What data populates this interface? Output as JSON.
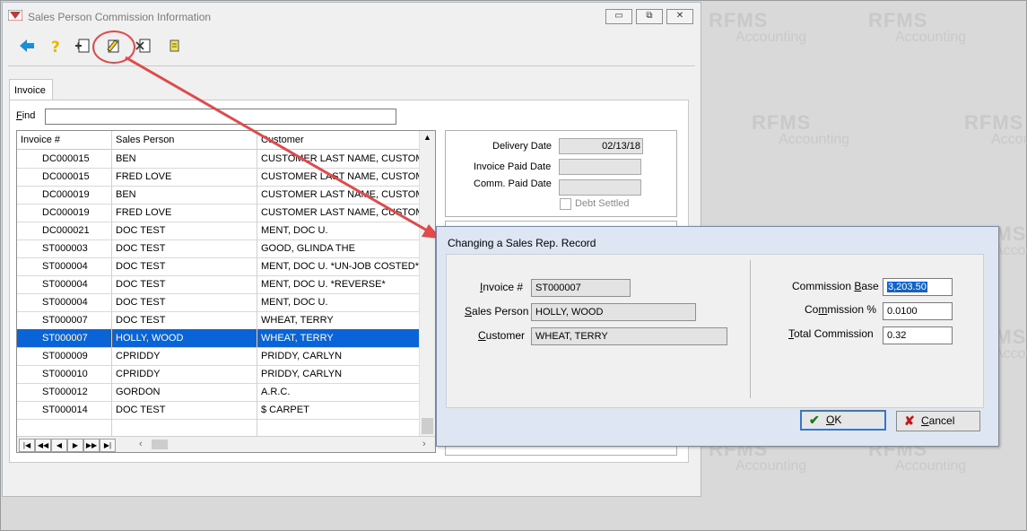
{
  "watermark": {
    "brand": "RFMS",
    "sub": "Accounting"
  },
  "window": {
    "title": "Sales Person Commission Information",
    "controls": {
      "minimize": "▭",
      "restore": "⧉",
      "close": "✕"
    }
  },
  "toolbar": {
    "icons": [
      "back-arrow-icon",
      "help-icon",
      "add-record-icon",
      "edit-record-icon",
      "delete-record-icon",
      "report-icon"
    ]
  },
  "tab": {
    "label": "Invoice"
  },
  "find": {
    "label_first": "F",
    "label_rest": "ind",
    "value": ""
  },
  "grid": {
    "columns": [
      "Invoice #",
      "Sales Person",
      "Customer"
    ],
    "rows": [
      [
        "DC000015",
        "BEN",
        "CUSTOMER LAST NAME, CUSTOME"
      ],
      [
        "DC000015",
        "FRED LOVE",
        "CUSTOMER LAST NAME, CUSTOME"
      ],
      [
        "DC000019",
        "BEN",
        "CUSTOMER LAST NAME, CUSTOME"
      ],
      [
        "DC000019",
        "FRED LOVE",
        "CUSTOMER LAST NAME, CUSTOME"
      ],
      [
        "DC000021",
        "DOC TEST",
        "MENT, DOC U."
      ],
      [
        "ST000003",
        "DOC TEST",
        "GOOD, GLINDA THE"
      ],
      [
        "ST000004",
        "DOC TEST",
        "MENT, DOC U.   *UN-JOB COSTED*"
      ],
      [
        "ST000004",
        "DOC TEST",
        "MENT, DOC U.         *REVERSE*"
      ],
      [
        "ST000004",
        "DOC TEST",
        "MENT, DOC U."
      ],
      [
        "ST000007",
        "DOC TEST",
        "WHEAT, TERRY"
      ],
      [
        "ST000007",
        "HOLLY, WOOD",
        "WHEAT, TERRY"
      ],
      [
        "ST000009",
        "CPRIDDY",
        "PRIDDY, CARLYN"
      ],
      [
        "ST000010",
        "CPRIDDY",
        "PRIDDY, CARLYN"
      ],
      [
        "ST000012",
        "GORDON",
        "A.R.C."
      ],
      [
        "ST000014",
        "DOC TEST",
        "$ CARPET"
      ]
    ],
    "selected_index": 10,
    "nav_buttons": [
      "|◀",
      "◀◀",
      "◀",
      "▶",
      "▶▶",
      "▶|"
    ]
  },
  "details": {
    "delivery_date_label": "Delivery Date",
    "delivery_date": "02/13/18",
    "invoice_paid_date_label": "Invoice Paid Date",
    "invoice_paid_date": "",
    "comm_paid_date_label": "Comm. Paid Date",
    "comm_paid_date": "",
    "debt_settled_label": "Debt Settled"
  },
  "dialog": {
    "title": "Changing a Sales Rep. Record",
    "invoice_label_u": "I",
    "invoice_label_rest": "nvoice #",
    "invoice_value": "ST000007",
    "sales_person_label_u": "S",
    "sales_person_label_rest": "ales Person",
    "sales_person_value": "HOLLY, WOOD",
    "customer_label_u": "C",
    "customer_label_rest": "ustomer",
    "customer_value": "WHEAT, TERRY",
    "commission_base_label_pre": "Commission ",
    "commission_base_label_u": "B",
    "commission_base_label_post": "ase",
    "commission_base_value": "3,203.50",
    "commission_pct_label_pre": "Co",
    "commission_pct_label_u": "m",
    "commission_pct_label_post": "mission %",
    "commission_pct_value": "0.0100",
    "total_commission_label_u": "T",
    "total_commission_label_rest": "otal Commission",
    "total_commission_value": "0.32",
    "ok_label_u": "O",
    "ok_label_rest": "K",
    "cancel_label_u": "C",
    "cancel_label_rest": "ancel"
  },
  "colors": {
    "selection": "#0a64d7",
    "annotation": "#e04a4a"
  }
}
